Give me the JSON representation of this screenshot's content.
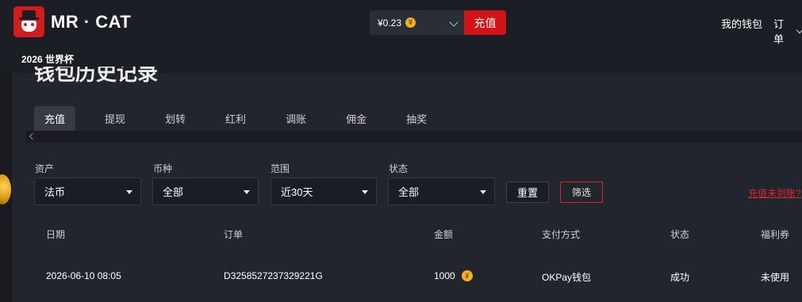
{
  "header": {
    "brand": "MR · CAT",
    "balance": "¥0.23",
    "coin_symbol": "¥",
    "recharge": "充值",
    "wallet": "我的钱包",
    "orders": "订单"
  },
  "subnav": {
    "worldcup": "2026 世界杯"
  },
  "page": {
    "title": "钱包历史记录",
    "tabs": [
      {
        "label": "充值",
        "active": true
      },
      {
        "label": "提现"
      },
      {
        "label": "划转"
      },
      {
        "label": "红利"
      },
      {
        "label": "调账"
      },
      {
        "label": "佣金"
      },
      {
        "label": "抽奖"
      }
    ]
  },
  "filters": {
    "asset": {
      "label": "资产",
      "value": "法币"
    },
    "currency": {
      "label": "币种",
      "value": "全部"
    },
    "range": {
      "label": "范围",
      "value": "近30天"
    },
    "status": {
      "label": "状态",
      "value": "全部"
    },
    "reset": "重置",
    "apply": "筛选",
    "help_link": "充值未到账?"
  },
  "table": {
    "headers": [
      "日期",
      "订单",
      "金额",
      "支付方式",
      "状态",
      "福利券"
    ],
    "rows": [
      {
        "date": "2026-06-10 08:05",
        "order": "D3258527237329221G",
        "amount": "1000",
        "method": "OKPay钱包",
        "status": "成功",
        "coupon": "未使用"
      }
    ]
  },
  "colors": {
    "accent_red": "#d21414",
    "coin_gold": "#f5b020",
    "background": "#22252e"
  }
}
